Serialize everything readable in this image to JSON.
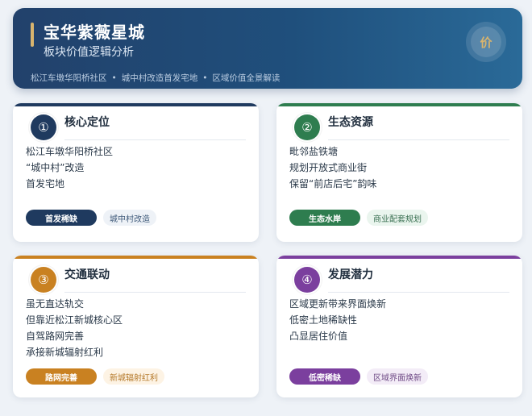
{
  "header": {
    "title": "宝华紫薇星城",
    "subtitle": "板块价值逻辑分析",
    "tags": [
      "松江车墩华阳桥社区",
      "城中村改造首发宅地",
      "区域价值全景解读"
    ],
    "badge": "价"
  },
  "cards": [
    {
      "number": "①",
      "title": "核心定位",
      "color": "#1f3a5f",
      "lines": [
        "松江车墩华阳桥社区",
        "“城中村”改造",
        "首发宅地"
      ],
      "tag_solid": "首发稀缺",
      "tag_soft": "城中村改造",
      "soft_bg": "#eef2f7",
      "soft_fg": "#3f5a7a"
    },
    {
      "number": "②",
      "title": "生态资源",
      "color": "#2e7d4f",
      "lines": [
        "毗邻盐铁塘",
        "规划开放式商业街",
        "保留“前店后宅”韵味"
      ],
      "tag_solid": "生态水岸",
      "tag_soft": "商业配套规划",
      "soft_bg": "#eaf5ee",
      "soft_fg": "#3a7052"
    },
    {
      "number": "③",
      "title": "交通联动",
      "color": "#c98121",
      "lines": [
        "虽无直达轨交",
        "但靠近松江新城核心区",
        "自驾路网完善",
        "承接新城辐射红利"
      ],
      "tag_solid": "路网完善",
      "tag_soft": "新城辐射红利",
      "soft_bg": "#fdf3e4",
      "soft_fg": "#b5792a"
    },
    {
      "number": "④",
      "title": "发展潜力",
      "color": "#7b3f9e",
      "lines": [
        "区域更新带来界面焕新",
        "低密土地稀缺性",
        "凸显居住价值"
      ],
      "tag_solid": "低密稀缺",
      "tag_soft": "区域界面焕新",
      "soft_bg": "#f3ecf7",
      "soft_fg": "#6f4a86"
    }
  ]
}
